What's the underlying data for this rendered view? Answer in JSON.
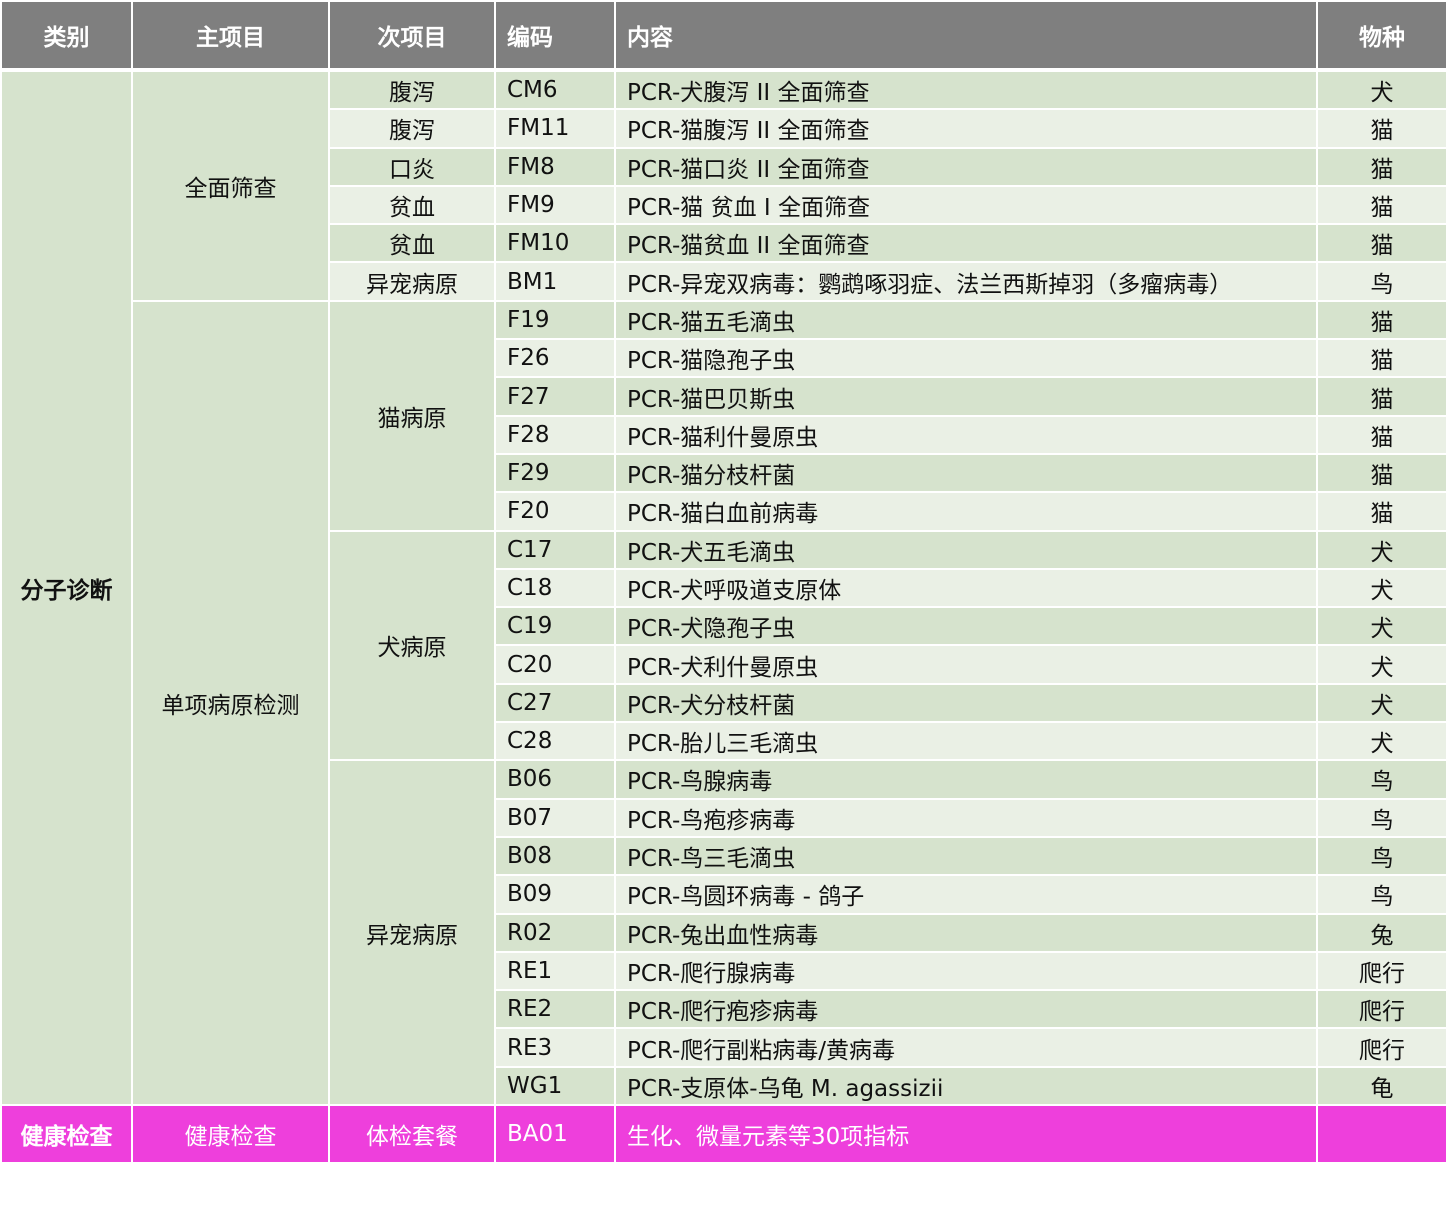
{
  "headers": {
    "category": "类别",
    "main_item": "主项目",
    "sub_item": "次项目",
    "code": "编码",
    "content": "内容",
    "species": "物种"
  },
  "groups": {
    "category_molecular": "分子诊断",
    "main_full": "全面筛查",
    "main_single": "单项病原检测",
    "sub_cat": "猫病原",
    "sub_dog": "犬病原",
    "sub_exotic": "异宠病原"
  },
  "rows": [
    {
      "sub": "腹泻",
      "code": "CM6",
      "content": "PCR-犬腹泻 II 全面筛查",
      "species": "犬"
    },
    {
      "sub": "腹泻",
      "code": "FM11",
      "content": "PCR-猫腹泻 II 全面筛查",
      "species": "猫"
    },
    {
      "sub": "口炎",
      "code": "FM8",
      "content": "PCR-猫口炎 II 全面筛查",
      "species": "猫"
    },
    {
      "sub": "贫血",
      "code": "FM9",
      "content": "PCR-猫 贫血 I 全面筛查",
      "species": "猫"
    },
    {
      "sub": "贫血",
      "code": "FM10",
      "content": "PCR-猫贫血 II 全面筛查",
      "species": "猫"
    },
    {
      "sub": "异宠病原",
      "code": "BM1",
      "content": "PCR-异宠双病毒：鹦鹉啄羽症、法兰西斯掉羽（多瘤病毒）",
      "species": "鸟"
    },
    {
      "code": "F19",
      "content": "PCR-猫五毛滴虫",
      "species": "猫"
    },
    {
      "code": "F26",
      "content": "PCR-猫隐孢子虫",
      "species": "猫"
    },
    {
      "code": "F27",
      "content": "PCR-猫巴贝斯虫",
      "species": "猫"
    },
    {
      "code": "F28",
      "content": "PCR-猫利什曼原虫",
      "species": "猫"
    },
    {
      "code": "F29",
      "content": "PCR-猫分枝杆菌",
      "species": "猫"
    },
    {
      "code": "F20",
      "content": "PCR-猫白血前病毒",
      "species": "猫"
    },
    {
      "code": "C17",
      "content": "PCR-犬五毛滴虫",
      "species": "犬"
    },
    {
      "code": "C18",
      "content": "PCR-犬呼吸道支原体",
      "species": "犬"
    },
    {
      "code": "C19",
      "content": "PCR-犬隐孢子虫",
      "species": "犬"
    },
    {
      "code": "C20",
      "content": "PCR-犬利什曼原虫",
      "species": "犬"
    },
    {
      "code": "C27",
      "content": "PCR-犬分枝杆菌",
      "species": "犬"
    },
    {
      "code": "C28",
      "content": "PCR-胎儿三毛滴虫",
      "species": "犬"
    },
    {
      "code": "B06",
      "content": "PCR-鸟腺病毒",
      "species": "鸟"
    },
    {
      "code": "B07",
      "content": "PCR-鸟疱疹病毒",
      "species": "鸟"
    },
    {
      "code": "B08",
      "content": "PCR-鸟三毛滴虫",
      "species": "鸟"
    },
    {
      "code": "B09",
      "content": "PCR-鸟圆环病毒 - 鸽子",
      "species": "鸟"
    },
    {
      "code": "R02",
      "content": "PCR-兔出血性病毒",
      "species": "兔"
    },
    {
      "code": "RE1",
      "content": "PCR-爬行腺病毒",
      "species": "爬行"
    },
    {
      "code": "RE2",
      "content": "PCR-爬行疱疹病毒",
      "species": "爬行"
    },
    {
      "code": "RE3",
      "content": "PCR-爬行副粘病毒/黄病毒",
      "species": "爬行"
    },
    {
      "code": "WG1",
      "content": "PCR-支原体-乌龟 M. agassizii",
      "species": "龟"
    }
  ],
  "health": {
    "category": "健康检查",
    "main": "健康检查",
    "sub": "体检套餐",
    "code": "BA01",
    "content": "生化、微量元素等30项指标",
    "species": ""
  },
  "colors": {
    "header_bg": "#7f7f7f",
    "row_dark": "#d6e3cd",
    "row_light": "#eaf0e5",
    "health_bg": "#ee3fdc"
  }
}
